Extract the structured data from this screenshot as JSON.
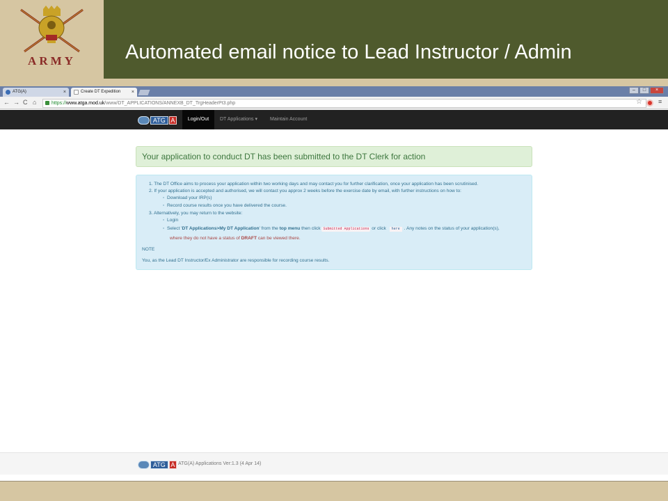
{
  "slide": {
    "title": "Automated email notice to Lead Instructor / Admin",
    "logo_text": "ARMY"
  },
  "browser": {
    "tabs": [
      {
        "label": "ATG(A)",
        "active": false
      },
      {
        "label": "Create DT Expedition",
        "active": true
      }
    ],
    "tab_close": "×",
    "url": {
      "scheme": "https://",
      "domain": "www.atga.mod.uk",
      "path": "/www/DT_APPLICATIONS/ANNEXB_DT_TrgHeaderPt3.php"
    }
  },
  "navbar": {
    "brand": {
      "atg": "ATG",
      "a": "A"
    },
    "items": [
      {
        "label": "Login/Out",
        "active": true
      },
      {
        "label": "DT Applications ▾",
        "active": false
      },
      {
        "label": "Maintain Account",
        "active": false
      }
    ]
  },
  "alert": {
    "text": "Your application to conduct DT has been submitted to the DT Clerk for action"
  },
  "info": {
    "item1": "1.  The DT Office aims to process your application within two working days and may contact you for further clarification, once your application has been scrutinised.",
    "item2": "2.  If your application is accepted and authorised, we will contact you approx 2 weeks before the exercise date by email, with further instructions on how to:",
    "item2_bullet1": "Download your IRP(s)",
    "item2_bullet2": "Record course results once you have delivered the course.",
    "item3": "3.  Alternatively, you may return to the website:",
    "item3_bullet1": "Login",
    "select_prefix": "Select '",
    "select_bold": "DT Applications>My DT Application",
    "select_mid": "' from the ",
    "select_menu": "top menu",
    "select_then": " then click ",
    "submitted_tag": "Submitted Applications",
    "or_click": " or click ",
    "here_tag": "here",
    "select_suffix": ". Any notes on the status of your application(s),",
    "draft_prefix": "where they do not have a status of ",
    "draft_word": "DRAFT",
    "draft_suffix": " can be viewed there.",
    "note_label": "NOTE",
    "note_text": "You, as the Lead DT Instructor/Ex Administrator are responsible for recording course results."
  },
  "footer": {
    "text": "ATG(A) Applications  Ver:1.3 (4 Apr 14)"
  },
  "colors": {
    "title_panel": "#4f5a2d",
    "slide_bg": "#d6c6a2",
    "army_red": "#8a2b27",
    "navbar_bg": "#222222",
    "alert_bg": "#dff0d8",
    "info_bg": "#d9edf7"
  },
  "icons": [
    "crest-icon",
    "back-icon",
    "forward-icon",
    "reload-icon",
    "home-icon",
    "lock-icon",
    "star-icon",
    "extension-icon",
    "menu-icon"
  ]
}
